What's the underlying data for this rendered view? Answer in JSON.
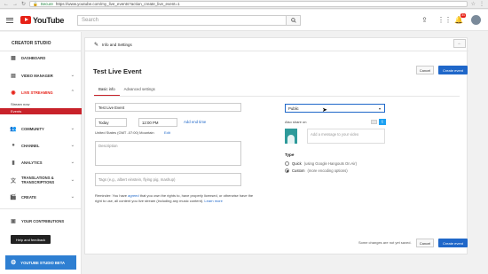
{
  "browser": {
    "secure_label": "Secure",
    "url": "https://www.youtube.com/my_live_events?action_create_live_event=1"
  },
  "youtube": {
    "logo_text": "YouTube",
    "search_placeholder": "Search",
    "notification_count": "31"
  },
  "sidebar": {
    "title": "CREATOR STUDIO",
    "items": [
      {
        "label": "DASHBOARD"
      },
      {
        "label": "VIDEO MANAGER"
      },
      {
        "label": "LIVE STREAMING"
      },
      {
        "label": "COMMUNITY"
      },
      {
        "label": "CHANNEL"
      },
      {
        "label": "ANALYTICS"
      },
      {
        "label": "TRANSLATIONS & TRANSCRIPTIONS"
      },
      {
        "label": "CREATE"
      },
      {
        "label": "YOUR CONTRIBUTIONS"
      }
    ],
    "sub_items": [
      {
        "label": "Stream now"
      },
      {
        "label": "Events"
      }
    ],
    "help_label": "Help and feedback",
    "beta_label": "YOUTUBE STUDIO BETA"
  },
  "page": {
    "header_label": "Info and Settings",
    "back_label": "←",
    "event_title": "Test Live Event",
    "cancel_label": "Cancel",
    "create_label": "Create event",
    "tabs": [
      {
        "label": "Basic info"
      },
      {
        "label": "Advanced settings"
      }
    ],
    "form": {
      "title_value": "Test Live Event",
      "date_value": "Today",
      "time_value": "12:00 PM",
      "add_end_time": "Add end time",
      "timezone": "United States (GMT -07:00) Mountain",
      "edit_label": "Edit",
      "description_placeholder": "Description",
      "tags_placeholder": "Tags (e.g., albert einstein, flying pig, mashup)",
      "reminder_text_1": "Reminder: You have",
      "reminder_link": "agreed",
      "reminder_text_2": "that you own the rights to, have properly licensed, or otherwise have the",
      "reminder_text_3": "right to use, all content you live stream (including any music content).",
      "learn_more": "Learn more"
    },
    "privacy": {
      "selected": "Public"
    },
    "share": {
      "label": "Also share on",
      "placeholder": "Add a message to your video"
    },
    "type": {
      "title": "Type",
      "option_quick": "Quick",
      "option_quick_note": "(using Google Hangouts On Air)",
      "option_custom": "Custom",
      "option_custom_note": "(more encoding options)"
    },
    "footer_note": "Some changes are not yet saved."
  }
}
